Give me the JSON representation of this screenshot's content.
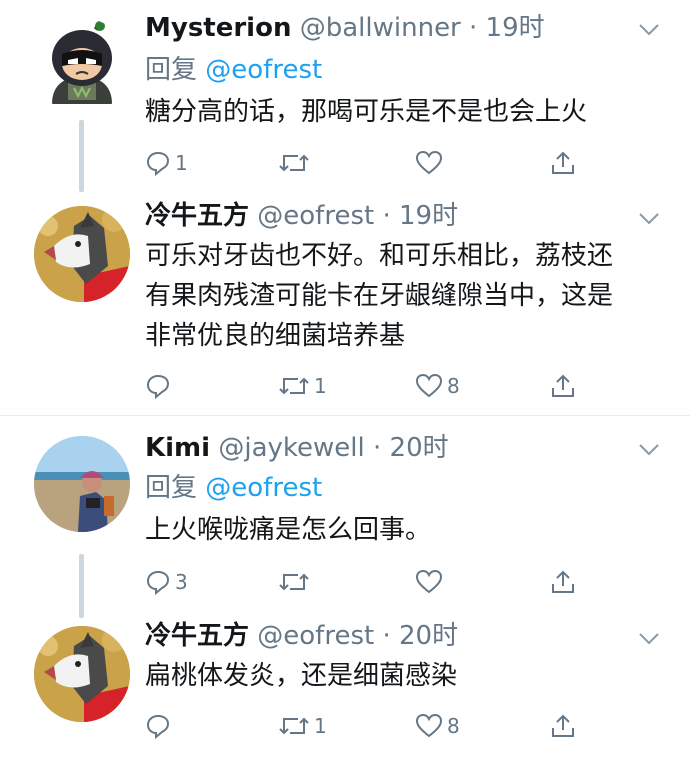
{
  "tweets": [
    {
      "name": "Mysterion",
      "handle": "@ballwinner",
      "time": "19时",
      "reply_label": "回复",
      "reply_to": "@eofrest",
      "text_lines": [
        "糖分高的话，那喝可乐是不是也会上火"
      ],
      "replies": "1",
      "retweets": "",
      "likes": ""
    },
    {
      "name": "冷牛五方",
      "handle": "@eofrest",
      "time": "19时",
      "text_lines": [
        "可乐对牙齿也不好。和可乐相比，荔枝还",
        "有果肉残渣可能卡在牙龈缝隙当中，这是",
        "非常优良的细菌培养基"
      ],
      "replies": "",
      "retweets": "1",
      "likes": "8"
    },
    {
      "name": "Kimi",
      "handle": "@jaykewell",
      "time": "20时",
      "reply_label": "回复",
      "reply_to": "@eofrest",
      "text_lines": [
        "上火喉咙痛是怎么回事。"
      ],
      "replies": "3",
      "retweets": "",
      "likes": ""
    },
    {
      "name": "冷牛五方",
      "handle": "@eofrest",
      "time": "20时",
      "text_lines": [
        "扁桃体发炎，还是细菌感染"
      ],
      "replies": "",
      "retweets": "1",
      "likes": "8"
    }
  ],
  "separator": "·",
  "colors": {
    "text": "#14171a",
    "secondary": "#657786",
    "link": "#1da1f2",
    "thread_line": "#ccd6dd",
    "divider": "#e6ecf0"
  },
  "icons": {
    "reply": "reply-icon",
    "retweet": "retweet-icon",
    "like": "heart-icon",
    "share": "share-icon",
    "more": "chevron-down-icon"
  }
}
